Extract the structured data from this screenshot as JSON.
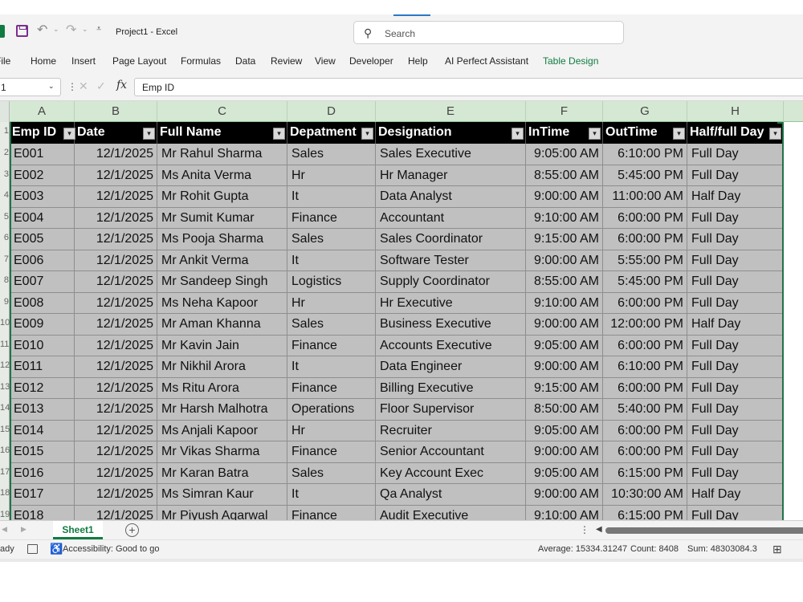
{
  "window": {
    "app_title": "Project1  -  Excel",
    "search_placeholder": "Search"
  },
  "ribbon": {
    "tabs": [
      "File",
      "Home",
      "Insert",
      "Page Layout",
      "Formulas",
      "Data",
      "Review",
      "View",
      "Developer",
      "Help",
      "AI Perfect Assistant",
      "Table Design"
    ]
  },
  "formula_bar": {
    "name_box": "1",
    "content": "Emp ID"
  },
  "columns": [
    "A",
    "B",
    "C",
    "D",
    "E",
    "F",
    "G",
    "H"
  ],
  "row_numbers": [
    "1",
    "2",
    "3",
    "4",
    "5",
    "6",
    "7",
    "8",
    "9",
    "10",
    "11",
    "12",
    "13",
    "14",
    "15",
    "16",
    "17",
    "18",
    "19"
  ],
  "table": {
    "headers": [
      "Emp ID",
      "Date",
      "Full Name",
      "Depatment",
      "Designation",
      "InTime",
      "OutTime",
      "Half/full Day"
    ],
    "rows": [
      [
        "E001",
        "12/1/2025",
        "Mr  Rahul  Sharma",
        "Sales",
        "Sales Executive",
        "9:05:00 AM",
        "6:10:00 PM",
        "Full Day"
      ],
      [
        "E002",
        "12/1/2025",
        "Ms  Anita  Verma",
        "Hr",
        "Hr Manager",
        "8:55:00 AM",
        "5:45:00 PM",
        "Full Day"
      ],
      [
        "E003",
        "12/1/2025",
        "Mr  Rohit  Gupta",
        "It",
        "Data Analyst",
        "9:00:00 AM",
        "11:00:00 AM",
        "Half Day"
      ],
      [
        "E004",
        "12/1/2025",
        "Mr  Sumit  Kumar",
        "Finance",
        "Accountant",
        "9:10:00 AM",
        "6:00:00 PM",
        "Full Day"
      ],
      [
        "E005",
        "12/1/2025",
        "Ms  Pooja  Sharma",
        "Sales",
        "Sales Coordinator",
        "9:15:00 AM",
        "6:00:00 PM",
        "Full Day"
      ],
      [
        "E006",
        "12/1/2025",
        "Mr  Ankit  Verma",
        "It",
        "Software Tester",
        "9:00:00 AM",
        "5:55:00 PM",
        "Full Day"
      ],
      [
        "E007",
        "12/1/2025",
        "Mr  Sandeep  Singh",
        "Logistics",
        "Supply Coordinator",
        "8:55:00 AM",
        "5:45:00 PM",
        "Full Day"
      ],
      [
        "E008",
        "12/1/2025",
        "Ms  Neha  Kapoor",
        "Hr",
        "Hr Executive",
        "9:10:00 AM",
        "6:00:00 PM",
        "Full Day"
      ],
      [
        "E009",
        "12/1/2025",
        "Mr  Aman  Khanna",
        "Sales",
        "Business Executive",
        "9:00:00 AM",
        "12:00:00 PM",
        "Half Day"
      ],
      [
        "E010",
        "12/1/2025",
        "Mr  Kavin  Jain",
        "Finance",
        "Accounts Executive",
        "9:05:00 AM",
        "6:00:00 PM",
        "Full Day"
      ],
      [
        "E011",
        "12/1/2025",
        "Mr  Nikhil  Arora",
        "It",
        "Data Engineer",
        "9:00:00 AM",
        "6:10:00 PM",
        "Full Day"
      ],
      [
        "E012",
        "12/1/2025",
        "Ms  Ritu  Arora",
        "Finance",
        "Billing Executive",
        "9:15:00 AM",
        "6:00:00 PM",
        "Full Day"
      ],
      [
        "E013",
        "12/1/2025",
        "Mr  Harsh  Malhotra",
        "Operations",
        "Floor Supervisor",
        "8:50:00 AM",
        "5:40:00 PM",
        "Full Day"
      ],
      [
        "E014",
        "12/1/2025",
        "Ms  Anjali  Kapoor",
        "Hr",
        "Recruiter",
        "9:05:00 AM",
        "6:00:00 PM",
        "Full Day"
      ],
      [
        "E015",
        "12/1/2025",
        "Mr  Vikas  Sharma",
        "Finance",
        "Senior Accountant",
        "9:00:00 AM",
        "6:00:00 PM",
        "Full Day"
      ],
      [
        "E016",
        "12/1/2025",
        "Mr  Karan  Batra",
        "Sales",
        "Key Account Exec",
        "9:05:00 AM",
        "6:15:00 PM",
        "Full Day"
      ],
      [
        "E017",
        "12/1/2025",
        "Ms  Simran  Kaur",
        "It",
        "Qa Analyst",
        "9:00:00 AM",
        "10:30:00 AM",
        "Half Day"
      ],
      [
        "E018",
        "12/1/2025",
        "Mr  Piyush  Agarwal",
        "Finance",
        "Audit Executive",
        "9:10:00 AM",
        "6:15:00 PM",
        "Full Day"
      ]
    ]
  },
  "sheets": {
    "active": "Sheet1"
  },
  "status": {
    "ready": "ady",
    "accessibility": "Accessibility: Good to go",
    "average": "Average: 15334.31247",
    "count": "Count: 8408",
    "sum": "Sum: 48303084.3"
  },
  "colors": {
    "excel_green": "#107c41",
    "table_header_bg": "#000000",
    "table_row_bg": "#c0c0c0",
    "column_header_selected": "#d5e8d4"
  }
}
